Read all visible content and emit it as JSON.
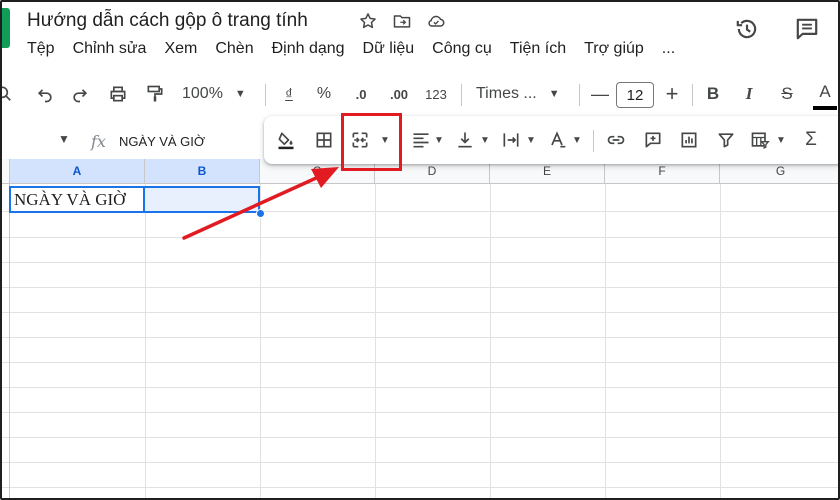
{
  "title_bar": {
    "doc_title": "Hướng dẫn cách gộp ô trang tính",
    "icons": [
      "star-icon",
      "move-to-folder-icon",
      "cloud-saved-icon"
    ],
    "right_icons": [
      "version-history-icon",
      "comments-icon"
    ]
  },
  "menu": {
    "items": [
      "Tệp",
      "Chỉnh sửa",
      "Xem",
      "Chèn",
      "Định dạng",
      "Dữ liệu",
      "Công cụ",
      "Tiện ích",
      "Trợ giúp",
      "..."
    ]
  },
  "toolbar": {
    "zoom": "100%",
    "currency": "₫",
    "percent": "%",
    "decrease_decimal": ".0",
    "increase_decimal": ".00",
    "number_format": "123",
    "font": "Times ...",
    "minus": "—",
    "font_size": "12",
    "plus": "+",
    "bold": "B",
    "italic": "I",
    "strike": "S",
    "text_color": "A"
  },
  "formula_bar": {
    "fx": "fx",
    "content": "NGÀY VÀ GIỜ"
  },
  "overflow_toolbar": {
    "items": [
      "fill-color-icon",
      "borders-icon",
      "merge-cells-icon",
      "horizontal-align-icon",
      "vertical-align-icon",
      "text-wrap-icon",
      "text-rotation-icon",
      "insert-link-icon",
      "insert-comment-icon",
      "insert-chart-icon",
      "filter-icon",
      "filter-views-icon",
      "functions-icon"
    ],
    "highlight_color": "#e21b23"
  },
  "grid": {
    "columns": [
      "A",
      "B",
      "C",
      "D",
      "E",
      "F",
      "G"
    ],
    "selected_columns": [
      "A",
      "B"
    ],
    "cell_a1": "NGÀY VÀ GIỜ"
  },
  "colors": {
    "accent_blue": "#1a73e8",
    "annotation_red": "#e21b23",
    "sheets_green": "#0f9d58"
  }
}
